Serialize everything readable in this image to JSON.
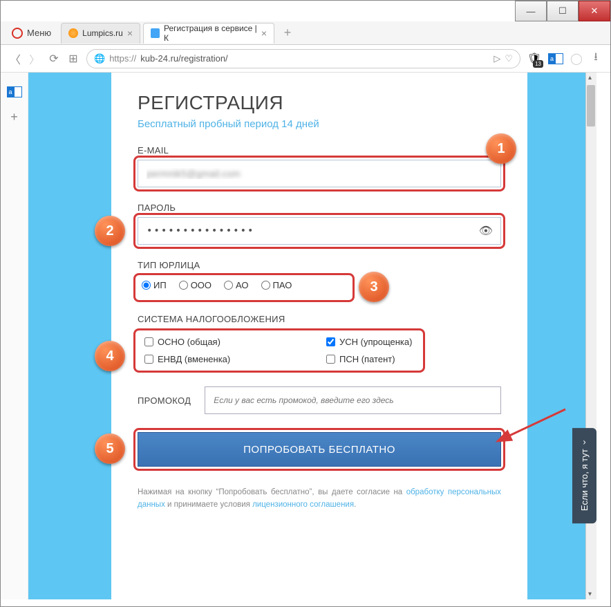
{
  "window": {
    "min": "—",
    "max": "☐",
    "close": "✕"
  },
  "opera": {
    "menu": "Меню"
  },
  "tabs": [
    {
      "title": "Lumpics.ru"
    },
    {
      "title": "Регистрация в сервисе | К"
    }
  ],
  "url": {
    "scheme": "https://",
    "rest": "kub-24.ru/registration/"
  },
  "notif": "13",
  "form": {
    "heading": "РЕГИСТРАЦИЯ",
    "subheading": "Бесплатный пробный период 14 дней",
    "email_label": "E-MAIL",
    "email_value": "permnik5@gmail.com",
    "password_label": "ПАРОЛЬ",
    "password_value": "•••••••••••••••",
    "entity_label": "ТИП ЮРЛИЦА",
    "entities": {
      "ip": "ИП",
      "ooo": "ООО",
      "ao": "АО",
      "pao": "ПАО"
    },
    "tax_label": "СИСТЕМА НАЛОГООБЛОЖЕНИЯ",
    "tax": {
      "osno": "ОСНО (общая)",
      "usn": "УСН (упрощенка)",
      "envd": "ЕНВД (вмененка)",
      "psn": "ПСН (патент)"
    },
    "promo_label": "ПРОМОКОД",
    "promo_placeholder": "Если у вас есть промокод, введите его здесь",
    "submit": "ПОПРОБОВАТЬ БЕСПЛАТНО",
    "legal_1": "Нажимая на кнопку “Попробовать бесплатно”, вы даете согласие на ",
    "legal_link1": "обработку персональных данных",
    "legal_2": " и принимаете условия ",
    "legal_link2": "лицензионного соглашения",
    "legal_3": "."
  },
  "markers": {
    "m1": "1",
    "m2": "2",
    "m3": "3",
    "m4": "4",
    "m5": "5"
  },
  "help": "Если что, я тут"
}
